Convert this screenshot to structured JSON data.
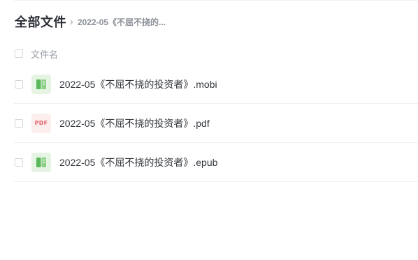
{
  "breadcrumb": {
    "root": "全部文件",
    "current": "2022-05《不屈不挠的..."
  },
  "list_header": {
    "column_name": "文件名"
  },
  "files": [
    {
      "name": "2022-05《不屈不挠的投资者》.mobi",
      "icon": "ebook-icon"
    },
    {
      "name": "2022-05《不屈不挠的投资者》.pdf",
      "icon": "pdf-icon",
      "icon_text": "PDF"
    },
    {
      "name": "2022-05《不屈不挠的投资者》.epub",
      "icon": "ebook-icon"
    }
  ],
  "colors": {
    "ebook_icon_bg": "#e6f5e3",
    "ebook_icon_fg": "#5cb85c",
    "pdf_icon_bg": "#fdeeee",
    "pdf_icon_fg": "#e5636b"
  }
}
